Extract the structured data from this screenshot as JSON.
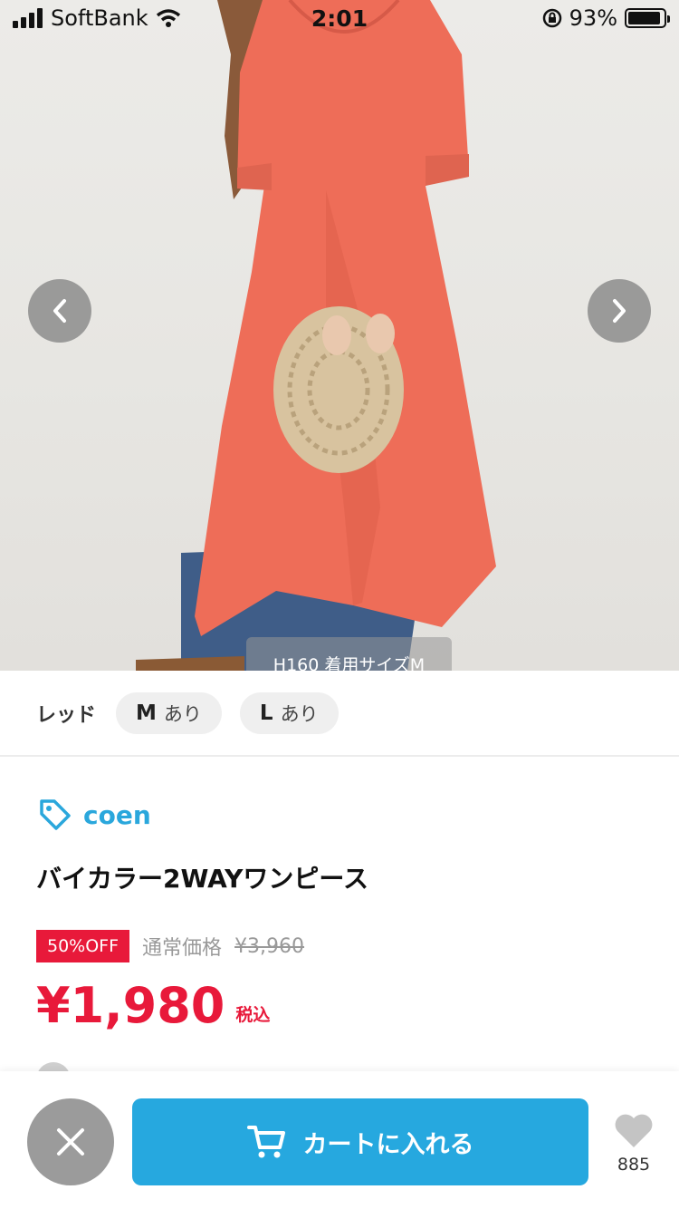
{
  "status_bar": {
    "carrier": "SoftBank",
    "time": "2:01",
    "battery_percent": "93%",
    "battery_level": 0.93
  },
  "gallery": {
    "prev_icon": "chevron-left-icon",
    "next_icon": "chevron-right-icon",
    "caption": "H160 着用サイズM"
  },
  "variation": {
    "color": "レッド",
    "sizes": [
      {
        "size": "M",
        "stock": "あり"
      },
      {
        "size": "L",
        "stock": "あり"
      }
    ]
  },
  "product": {
    "brand_icon": "tag-icon",
    "brand": "coen",
    "title": "バイカラー2WAYワンピース",
    "discount_badge": "50%OFF",
    "regular_label": "通常価格",
    "regular_price": "¥3,960",
    "price": "¥1,980",
    "tax_label": "税込"
  },
  "bottom_bar": {
    "close_icon": "close-icon",
    "cart_icon": "cart-icon",
    "cart_label": "カートに入れる",
    "favorite_icon": "heart-icon",
    "favorite_count": "885"
  },
  "colors": {
    "accent_blue": "#26a8df",
    "sale_red": "#e8193a",
    "dress": "#ee6d58"
  }
}
